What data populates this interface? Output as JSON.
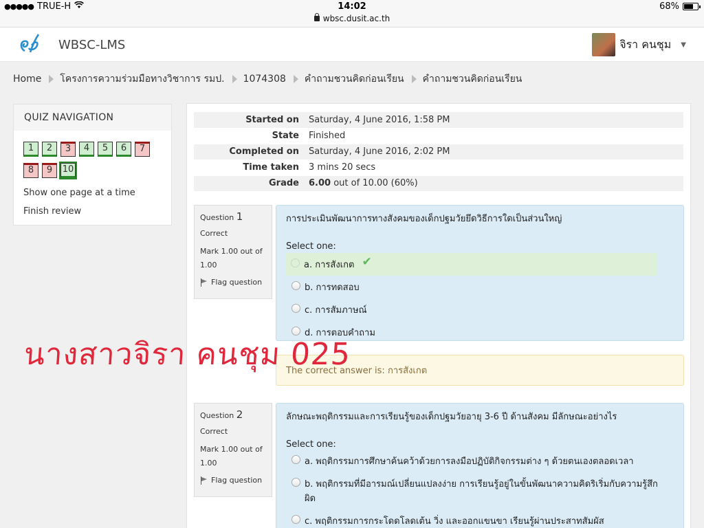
{
  "status_bar": {
    "carrier": "TRUE-H",
    "time": "14:02",
    "battery_percent": "68%",
    "battery_level": 0.68
  },
  "url_bar": {
    "url": "wbsc.dusit.ac.th"
  },
  "header": {
    "site_name": "WBSC-LMS",
    "user_name": "จิรา คนชุม"
  },
  "breadcrumb": [
    "Home",
    "โครงการความร่วมมือทางวิชาการ รมป.",
    "1074308",
    "คำถามชวนคิดก่อนเรียน",
    "คำถามชวนคิดก่อนเรียน"
  ],
  "quiz_nav": {
    "title": "QUIZ NAVIGATION",
    "questions": [
      {
        "label": "1",
        "state": "correct"
      },
      {
        "label": "2",
        "state": "correct"
      },
      {
        "label": "3",
        "state": "incorrect"
      },
      {
        "label": "4",
        "state": "correct"
      },
      {
        "label": "5",
        "state": "correct"
      },
      {
        "label": "6",
        "state": "correct"
      },
      {
        "label": "7",
        "state": "incorrect"
      },
      {
        "label": "8",
        "state": "incorrect"
      },
      {
        "label": "9",
        "state": "incorrect"
      },
      {
        "label": "10",
        "state": "correct"
      }
    ],
    "show_one_page": "Show one page at a time",
    "finish_review": "Finish review"
  },
  "summary": {
    "rows": [
      {
        "label": "Started on",
        "value": "Saturday, 4 June 2016, 1:58 PM"
      },
      {
        "label": "State",
        "value": "Finished"
      },
      {
        "label": "Completed on",
        "value": "Saturday, 4 June 2016, 2:02 PM"
      },
      {
        "label": "Time taken",
        "value": "3 mins 20 secs"
      }
    ],
    "grade_label": "Grade",
    "grade_value": "6.00",
    "grade_rest": " out of 10.00 (60%)"
  },
  "questions": [
    {
      "prefix": "Question ",
      "number": "1",
      "status": "Correct",
      "mark": "Mark 1.00 out of 1.00",
      "flag": "Flag question",
      "text": "การประเมินพัฒนาการทางสังคมของเด็กปฐมวัยยึดวิธีการใดเป็นส่วนใหญ่",
      "select_one": "Select one:",
      "answers": [
        "a. การสังเกต",
        "b. การทดสอบ",
        "c. การสัมภาษณ์",
        "d. การตอบคำถาม"
      ],
      "feedback": "The correct answer is: การสังเกต"
    },
    {
      "prefix": "Question ",
      "number": "2",
      "status": "Correct",
      "mark": "Mark 1.00 out of 1.00",
      "flag": "Flag question",
      "text": "ลักษณะพฤติกรรมและการเรียนรู้ของเด็กปฐมวัยอายุ 3-6 ปี ด้านสังคม มีลักษณะอย่างไร",
      "select_one": "Select one:",
      "answers": [
        "a. พฤติกรรมการศึกษาค้นคว้าด้วยการลงมือปฏิบัติกิจกรรมต่าง ๆ ด้วยตนเองตลอดเวลา",
        "b. พฤติกรรมที่มีอารมณ์เปลี่ยนแปลงง่าย การเรียนรู้อยู่ในขั้นพัฒนาความคิดริเริ่มกับความรู้สึกผิด",
        "c. พฤติกรรมการกระโดดโลดเต้น วิ่ง และออกแขนขา เรียนรู้ผ่านประสาทสัมผัส"
      ]
    }
  ],
  "handwritten_note": "นางสาวจิรา คนชุม 025"
}
